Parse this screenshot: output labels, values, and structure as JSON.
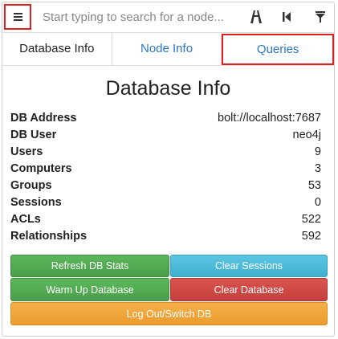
{
  "search": {
    "placeholder": "Start typing to search for a node..."
  },
  "toolbar": {
    "icons": [
      "menu-icon",
      "path-icon",
      "back-icon",
      "filter-icon"
    ]
  },
  "tabs": [
    {
      "label": "Database Info"
    },
    {
      "label": "Node Info"
    },
    {
      "label": "Queries"
    }
  ],
  "main": {
    "title": "Database Info",
    "rows": [
      {
        "key": "DB Address",
        "value": "bolt://localhost:7687"
      },
      {
        "key": "DB User",
        "value": "neo4j"
      },
      {
        "key": "Users",
        "value": "9"
      },
      {
        "key": "Computers",
        "value": "3"
      },
      {
        "key": "Groups",
        "value": "53"
      },
      {
        "key": "Sessions",
        "value": "0"
      },
      {
        "key": "ACLs",
        "value": "522"
      },
      {
        "key": "Relationships",
        "value": "592"
      }
    ]
  },
  "buttons": {
    "refresh": "Refresh DB Stats",
    "clear_sessions": "Clear Sessions",
    "warm_up": "Warm Up Database",
    "clear_db": "Clear Database",
    "logout": "Log Out/Switch DB"
  },
  "colors": {
    "highlight": "#e02020",
    "link": "#2a78c9",
    "green": "#5cb85c",
    "blue": "#5bc6e2",
    "red": "#d9534f",
    "orange": "#f4b04c"
  }
}
